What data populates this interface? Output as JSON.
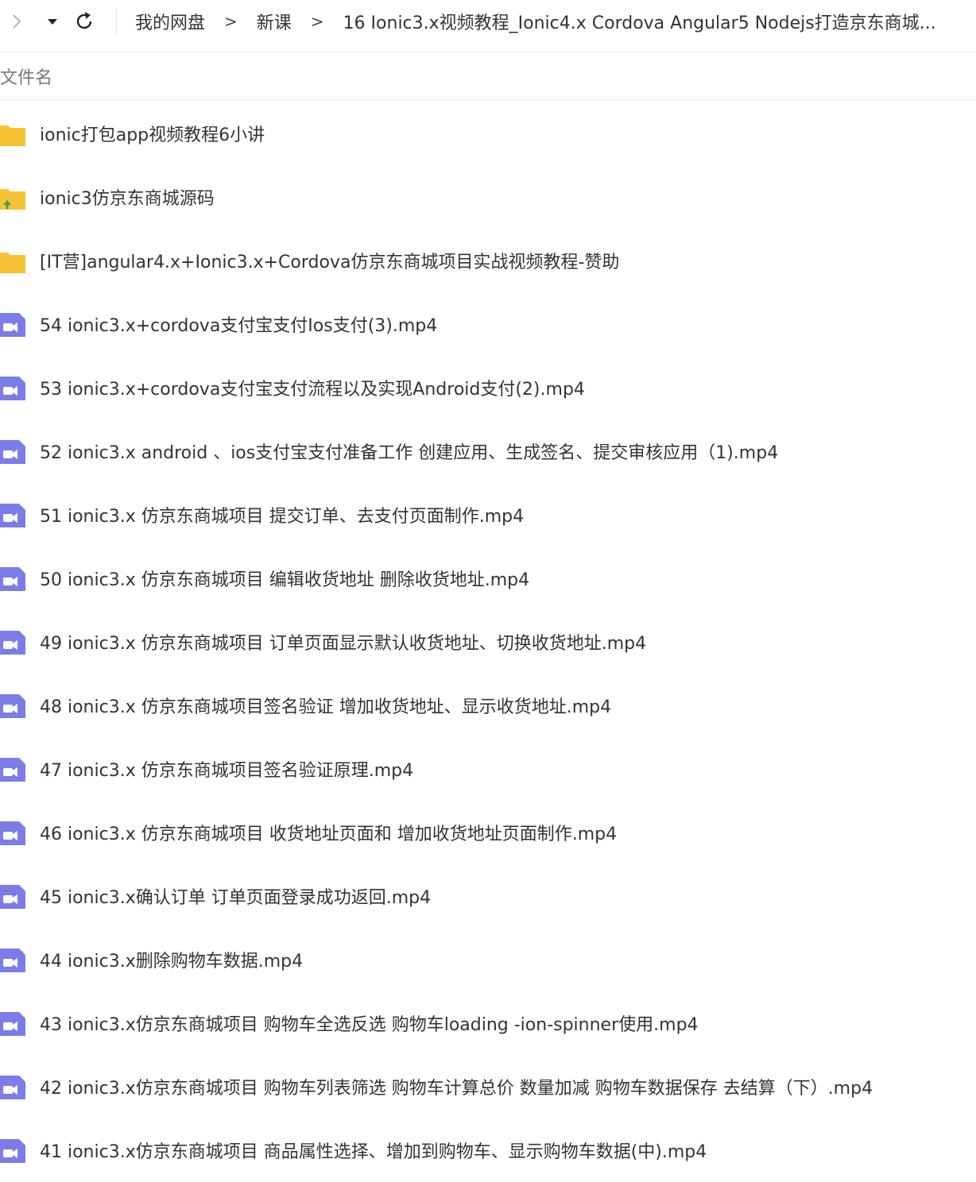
{
  "toolbar": {
    "forward_icon": "chevron-right-icon",
    "dropdown_icon": "caret-down-icon",
    "refresh_icon": "refresh-icon"
  },
  "breadcrumb": {
    "items": [
      "我的网盘",
      "新课",
      "16 Ionic3.x视频教程_Ionic4.x Cordova Angular5 Nodejs打造京东商城..."
    ],
    "separator": ">"
  },
  "list_header": {
    "filename_label": "文件名"
  },
  "files": [
    {
      "name": "ionic打包app视频教程6小讲",
      "icon": "folder-icon"
    },
    {
      "name": "ionic3仿京东商城源码",
      "icon": "upload-folder-icon"
    },
    {
      "name": "[IT营]angular4.x+Ionic3.x+Cordova仿京东商城项目实战视频教程-赞助",
      "icon": "folder-icon"
    },
    {
      "name": "54 ionic3.x+cordova支付宝支付Ios支付(3).mp4",
      "icon": "video-icon"
    },
    {
      "name": "53 ionic3.x+cordova支付宝支付流程以及实现Android支付(2).mp4",
      "icon": "video-icon"
    },
    {
      "name": "52 ionic3.x android 、ios支付宝支付准备工作 创建应用、生成签名、提交审核应用（1).mp4",
      "icon": "video-icon"
    },
    {
      "name": "51 ionic3.x 仿京东商城项目 提交订单、去支付页面制作.mp4",
      "icon": "video-icon"
    },
    {
      "name": "50  ionic3.x 仿京东商城项目 编辑收货地址 删除收货地址.mp4",
      "icon": "video-icon"
    },
    {
      "name": "49 ionic3.x 仿京东商城项目 订单页面显示默认收货地址、切换收货地址.mp4",
      "icon": "video-icon"
    },
    {
      "name": "48 ionic3.x 仿京东商城项目签名验证 增加收货地址、显示收货地址.mp4",
      "icon": "video-icon"
    },
    {
      "name": "47 ionic3.x 仿京东商城项目签名验证原理.mp4",
      "icon": "video-icon"
    },
    {
      "name": "46 ionic3.x 仿京东商城项目 收货地址页面和 增加收货地址页面制作.mp4",
      "icon": "video-icon"
    },
    {
      "name": "45 ionic3.x确认订单 订单页面登录成功返回.mp4",
      "icon": "video-icon"
    },
    {
      "name": "44 ionic3.x删除购物车数据.mp4",
      "icon": "video-icon"
    },
    {
      "name": "43 ionic3.x仿京东商城项目 购物车全选反选 购物车loading -ion-spinner使用.mp4",
      "icon": "video-icon"
    },
    {
      "name": "42 ionic3.x仿京东商城项目 购物车列表筛选 购物车计算总价 数量加减 购物车数据保存 去结算（下）.mp4",
      "icon": "video-icon"
    },
    {
      "name": "41 ionic3.x仿京东商城项目 商品属性选择、增加到购物车、显示购物车数据(中).mp4",
      "icon": "video-icon"
    }
  ],
  "colors": {
    "folder": "#f7c334",
    "video": "#7b7ce8",
    "upload_arrow": "#3aa24a",
    "divider": "#ececec"
  }
}
